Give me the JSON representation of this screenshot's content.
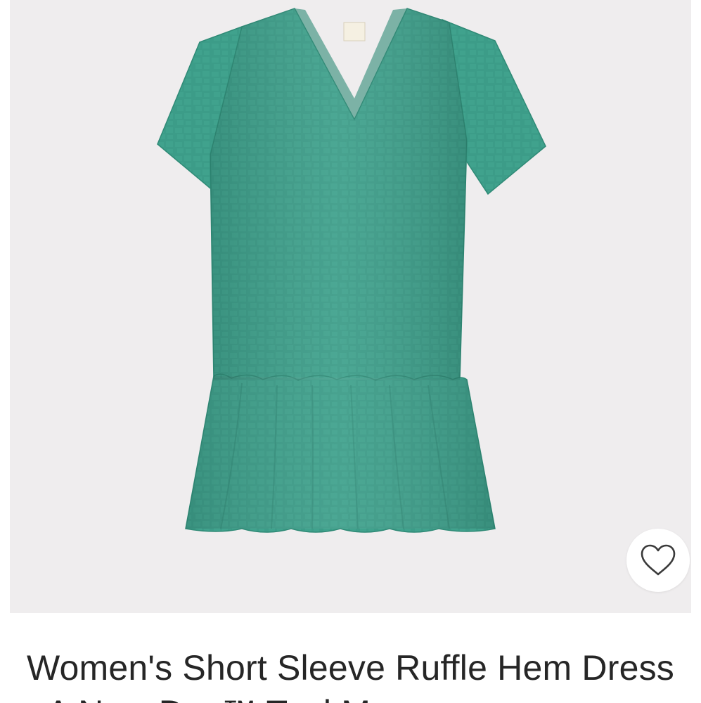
{
  "product": {
    "title": "Women's Short Sleeve Ruffle Hem Dress - A New Day™ Teal M",
    "image_icon": "dress-photo",
    "favorite_icon": "heart-outline-icon",
    "colors": {
      "image_background": "#efedee",
      "dress": "#3a9a86",
      "title_text": "#262626"
    }
  }
}
